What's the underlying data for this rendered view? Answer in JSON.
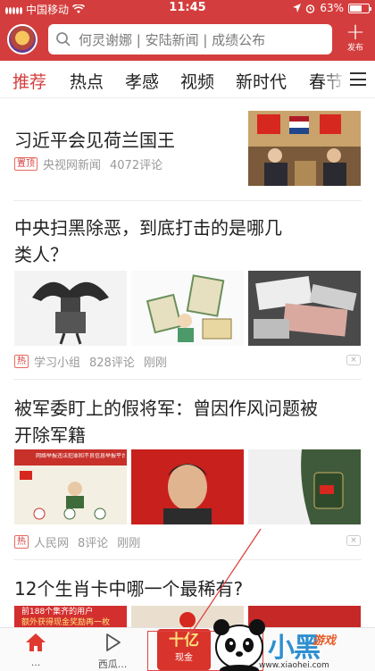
{
  "status_bar": {
    "carrier": "中国移动",
    "time": "11:45",
    "battery": "63%"
  },
  "header": {
    "search_placeholder": "何灵谢娜 | 安陆新闻 | 成绩公布",
    "publish_label": "发布"
  },
  "tabs": [
    {
      "label": "推荐",
      "active": true
    },
    {
      "label": "热点",
      "active": false
    },
    {
      "label": "孝感",
      "active": false
    },
    {
      "label": "视频",
      "active": false
    },
    {
      "label": "新时代",
      "active": false
    },
    {
      "label": "春节",
      "active": false
    }
  ],
  "articles": [
    {
      "title": "习近平会见荷兰国王",
      "badge": "置顶",
      "source": "央视网新闻",
      "comments": "4072评论"
    },
    {
      "title_line1": "中央扫黑除恶，到底打击的是哪几",
      "title_line2": "类人？",
      "badge": "热",
      "source": "学习小组",
      "comments": "828评论",
      "time": "刚刚",
      "close": "×"
    },
    {
      "title_line1": "被军委盯上的假将军：曾因作风问题被",
      "title_line2": "开除军籍",
      "badge": "热",
      "source": "人民网",
      "comments": "8评论",
      "time": "刚刚",
      "close": "×",
      "thumb_banner_text": "网络举报违法犯罪和不良信息举报平台"
    },
    {
      "title": "12个生肖卡中哪一个最稀有?",
      "ad_line1": "前188个集齐的用户",
      "ad_line2": "额外获得现金奖励再一枚"
    }
  ],
  "bottom_bar": {
    "home_label": "...",
    "video_label": "西瓜...",
    "red_packet_big": "十亿",
    "red_packet_small": "现金"
  },
  "watermark": {
    "title": "小黑",
    "subtitle": "游戏",
    "url": "www.xiaohei.com"
  },
  "colors": {
    "brand_red": "#d43d3d",
    "text_dark": "#222222",
    "meta_gray": "#999999"
  }
}
